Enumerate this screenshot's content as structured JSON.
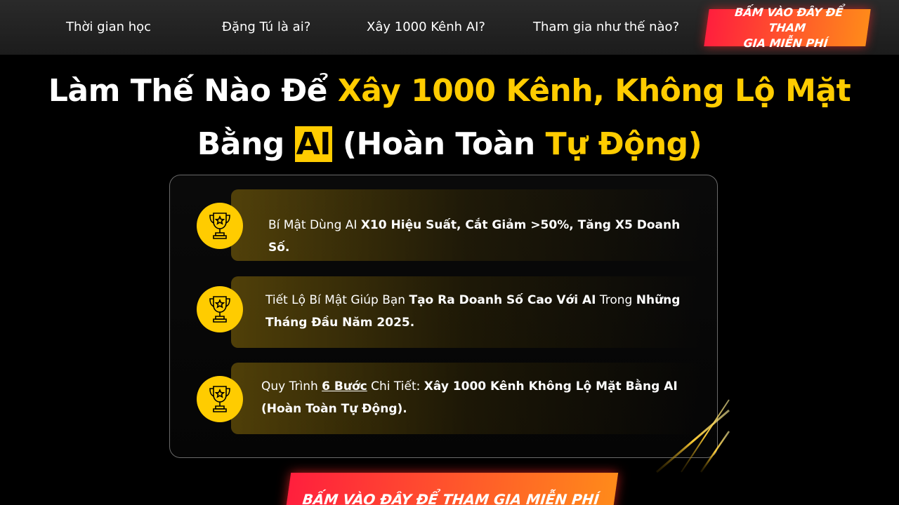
{
  "nav": {
    "items": [
      {
        "label": "Thời gian học"
      },
      {
        "label": "Đặng Tú là ai?"
      },
      {
        "label": "Xây 1000 Kênh AI?"
      },
      {
        "label": "Tham gia như thế nào?"
      }
    ],
    "cta_line1": "BẤM VÀO ĐÂY ĐỂ THAM",
    "cta_line2": "GIA MIỄN PHÍ"
  },
  "headline": {
    "line1_a": "Làm Thế Nào Để ",
    "line1_b": "Xây 1000 Kênh, Không Lộ Mặt",
    "line2_a": "Bằng ",
    "line2_box": "AI",
    "line2_b": " (Hoàn Toàn ",
    "line2_c": "Tự Động)"
  },
  "benefits": [
    {
      "p1": "Bí Mật Dùng AI ",
      "b1": "X10 Hiệu Suất, Cắt Giảm >50%, Tăng X5 Doanh Số."
    },
    {
      "p1": "Tiết Lộ Bí Mật Giúp Bạn ",
      "b1": "Tạo Ra Doanh Số Cao Với AI",
      "p2": " Trong ",
      "b2": "Những",
      "b3": "Tháng Đầu Năm 2025."
    },
    {
      "p1": "Quy Trình ",
      "u1": "6 Bước",
      "p2": " Chi Tiết: ",
      "b1": "Xây 1000 Kênh Không Lộ Mặt Bằng AI",
      "b2": "(Hoàn Toàn Tự Động)."
    }
  ],
  "cta_bottom": "BẤM VÀO ĐÂY ĐỂ THAM GIA MIỄN PHÍ",
  "colors": {
    "accent_yellow": "#ffcc00",
    "cta_red": "#ff1f3d",
    "cta_orange": "#ff8a1a",
    "background": "#000000"
  },
  "icons": [
    "trophy-icon"
  ]
}
